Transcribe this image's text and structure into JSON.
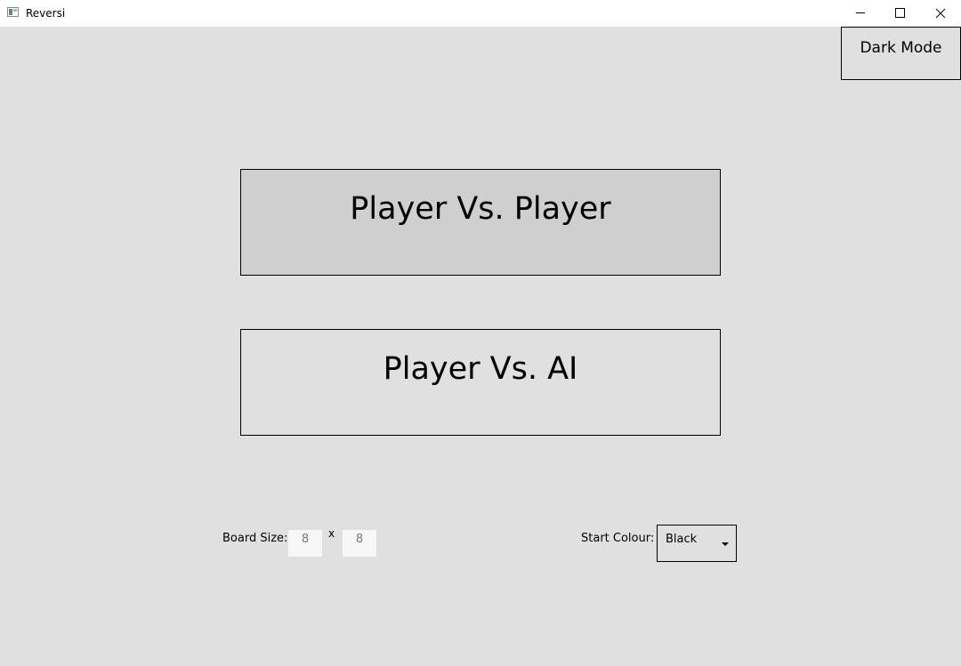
{
  "window": {
    "title": "Reversi",
    "icon": "app-window-icon"
  },
  "caption": {
    "minimize_icon": "minimize-icon",
    "maximize_icon": "maximize-icon",
    "close_icon": "close-icon"
  },
  "toolbar": {
    "dark_mode_label": "Dark Mode"
  },
  "menu": {
    "pvp_label": "Player Vs. Player",
    "pvai_label": "Player Vs. AI"
  },
  "settings": {
    "board_size_label": "Board Size:",
    "board_width": "8",
    "times_symbol": "x",
    "board_height": "8",
    "start_colour_label": "Start Colour:",
    "start_colour_value": "Black"
  },
  "colors": {
    "background": "#e0e0e0",
    "pvp_highlight": "#cfcfcf",
    "titlebar": "#ffffff"
  }
}
